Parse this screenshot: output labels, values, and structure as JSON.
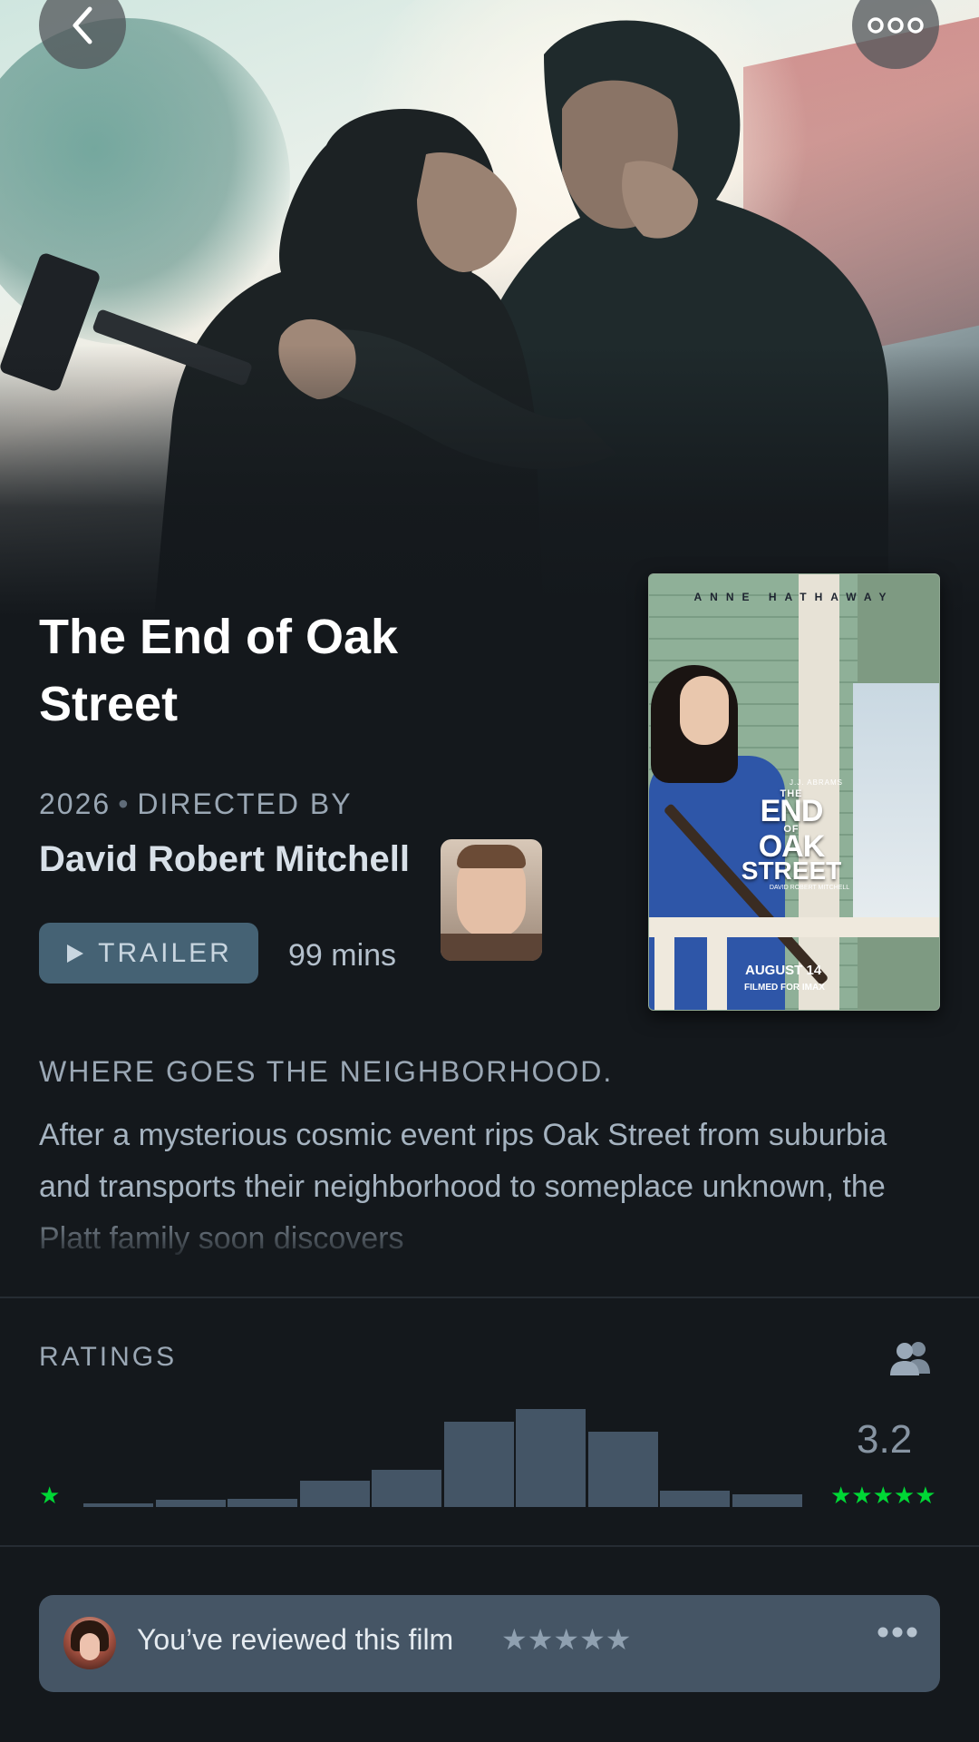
{
  "nav": {
    "back_icon": "chevron-left-icon",
    "more_icon": "ellipsis-icon"
  },
  "poster": {
    "top_name": "ANNE HATHAWAY",
    "credit_top": "J.J. ABRAMS",
    "title_line1": "THE",
    "title_line2": "END",
    "title_line3": "OF",
    "title_line4": "OAK",
    "title_line5": "STREET",
    "credit_bottom": "DAVID ROBERT MITCHELL",
    "release": "AUGUST 14",
    "format": "FILMED FOR IMAX"
  },
  "film": {
    "title": "The End of Oak Street",
    "year": "2026",
    "separator": "•",
    "directed_by_label": "DIRECTED BY",
    "director": "David Robert Mitchell",
    "trailer_label": "TRAILER",
    "runtime": "99 mins",
    "tagline": "WHERE GOES THE NEIGHBORHOOD.",
    "synopsis": "After a mysterious cosmic event rips Oak Street from suburbia and transports their neighborhood to someplace unknown, the Platt family soon discovers"
  },
  "ratings": {
    "label": "RATINGS",
    "average": "3.2",
    "min_star": "★",
    "max_stars": "★★★★★",
    "histogram": [
      0.04,
      0.07,
      0.08,
      0.27,
      0.38,
      0.87,
      1.0,
      0.77,
      0.17,
      0.13
    ],
    "star_color": "#00d735",
    "bar_color": "#445566"
  },
  "review": {
    "text": "You’ve reviewed this film",
    "stars": "★★★★★",
    "more_icon": "ellipsis-icon"
  },
  "colors": {
    "background": "#14181c",
    "accent_green": "#00d735",
    "button_bg": "#456274"
  }
}
